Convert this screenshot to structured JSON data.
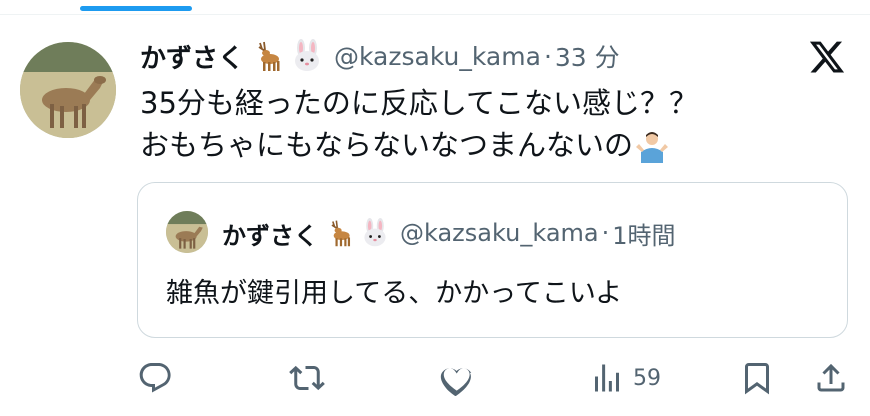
{
  "tweet": {
    "display_name": "かずさく",
    "handle": "@kazsaku_kama",
    "separator": "·",
    "time": "33 分",
    "text_lines": [
      "35分も経ったのに反応してこない感じ？？",
      "おもちゃにもならないなつまんないの"
    ]
  },
  "quoted": {
    "display_name": "かずさく",
    "handle": "@kazsaku_kama",
    "separator": "·",
    "time": "1時間",
    "text": "雑魚が鍵引用してる、かかってこいよ"
  },
  "actions": {
    "views_count": "59"
  },
  "icons": {
    "reply": "reply-icon",
    "retweet": "retweet-icon",
    "like": "heart-icon",
    "views": "views-icon",
    "bookmark": "bookmark-icon",
    "share": "share-icon",
    "logo": "x-logo-icon"
  },
  "colors": {
    "accent": "#1d9bf0",
    "text": "#0f1419",
    "secondary": "#536471",
    "border": "#cfd9de"
  }
}
